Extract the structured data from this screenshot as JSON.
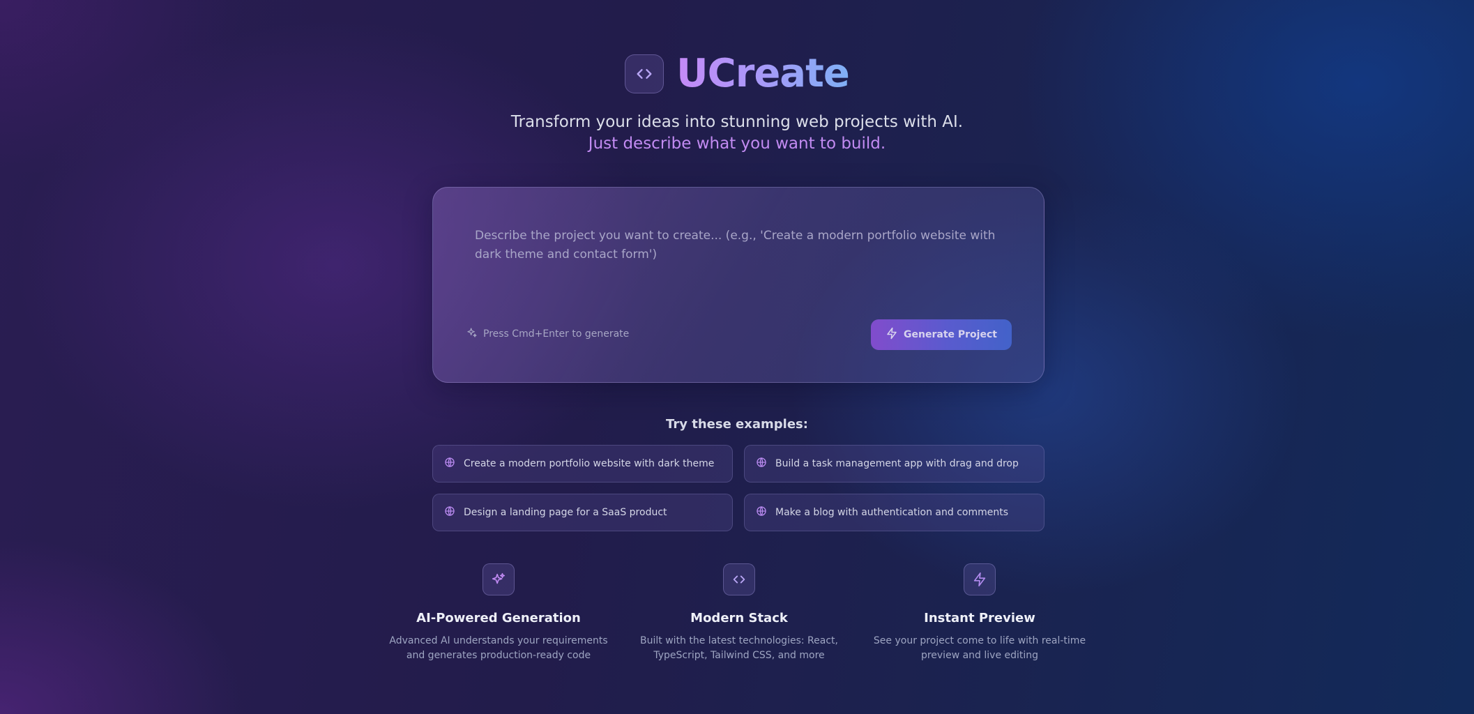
{
  "brand": {
    "name": "UCreate",
    "icon": "code-icon"
  },
  "tagline": {
    "line1": "Transform your ideas into stunning web projects with AI.",
    "line2": "Just describe what you want to build."
  },
  "prompt": {
    "placeholder": "Describe the project you want to create... (e.g., 'Create a modern portfolio website with dark theme and contact form')",
    "value": "",
    "hint": "Press Cmd+Enter to generate",
    "hint_icon": "sparkles-icon",
    "generate_label": "Generate Project",
    "generate_icon": "lightning-icon"
  },
  "examples": {
    "title": "Try these examples:",
    "items": [
      {
        "label": "Create a modern portfolio website with dark theme",
        "icon": "globe-icon"
      },
      {
        "label": "Build a task management app with drag and drop",
        "icon": "globe-icon"
      },
      {
        "label": "Design a landing page for a SaaS product",
        "icon": "globe-icon"
      },
      {
        "label": "Make a blog with authentication and comments",
        "icon": "globe-icon"
      }
    ]
  },
  "features": [
    {
      "icon": "sparkles-icon",
      "title": "AI-Powered Generation",
      "desc_line1": "Advanced AI understands your requirements",
      "desc_line2": "and generates production-ready code"
    },
    {
      "icon": "code-icon",
      "title": "Modern Stack",
      "desc_line1": "Built with the latest technologies: React,",
      "desc_line2": "TypeScript, Tailwind CSS, and more"
    },
    {
      "icon": "lightning-icon",
      "title": "Instant Preview",
      "desc_line1": "See your project come to life with real-time",
      "desc_line2": "preview and live editing"
    }
  ],
  "colors": {
    "accent_purple": "#c28bf2",
    "accent_blue": "#7fb0f5",
    "button_gradient_start": "#8a4fd6",
    "button_gradient_end": "#4567d2"
  }
}
